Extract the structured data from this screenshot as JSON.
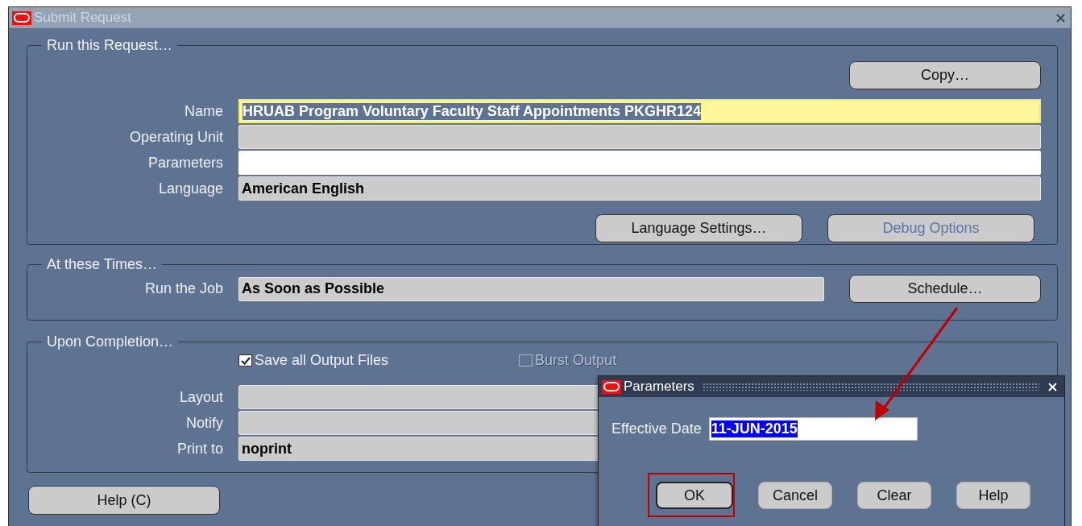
{
  "window": {
    "title": "Submit Request"
  },
  "run_request": {
    "legend": "Run this Request…",
    "copy_button": {
      "label": "Copy…"
    },
    "fields": [
      {
        "label": "Name",
        "value": "HRUAB Program Voluntary Faculty Staff Appointments PKGHR124",
        "kind": "focused"
      },
      {
        "label": "Operating Unit",
        "kind": "readonly"
      },
      {
        "label": "Parameters",
        "kind": "editable"
      },
      {
        "label": "Language",
        "value": "American English",
        "kind": "readonly"
      }
    ],
    "buttons": [
      {
        "label": "Language Settings…",
        "disabled": false
      },
      {
        "label": "Debug Options",
        "disabled": true
      }
    ]
  },
  "times": {
    "legend": "At these Times…",
    "run_job": {
      "label": "Run the Job",
      "value": "As Soon as Possible"
    },
    "schedule_button": {
      "label": "Schedule…"
    }
  },
  "completion": {
    "legend": "Upon Completion…",
    "checkboxes": [
      {
        "label": "Save all Output Files",
        "checked": true,
        "disabled": false
      },
      {
        "label": "Burst Output",
        "checked": false,
        "disabled": true
      }
    ],
    "fields": [
      {
        "label": "Layout",
        "kind": "readonly"
      },
      {
        "label": "Notify",
        "kind": "readonly"
      },
      {
        "label": "Print to",
        "value": "noprint",
        "kind": "readonly"
      }
    ]
  },
  "help_button": {
    "label": "Help (C)"
  },
  "dialog": {
    "title": "Parameters",
    "field": {
      "label": "Effective Date",
      "value": "11-JUN-2015",
      "selected": true
    },
    "buttons": [
      {
        "label": "OK",
        "default": true
      },
      {
        "label": "Cancel",
        "default": false
      },
      {
        "label": "Clear",
        "default": false
      },
      {
        "label": "Help",
        "default": false
      }
    ]
  }
}
